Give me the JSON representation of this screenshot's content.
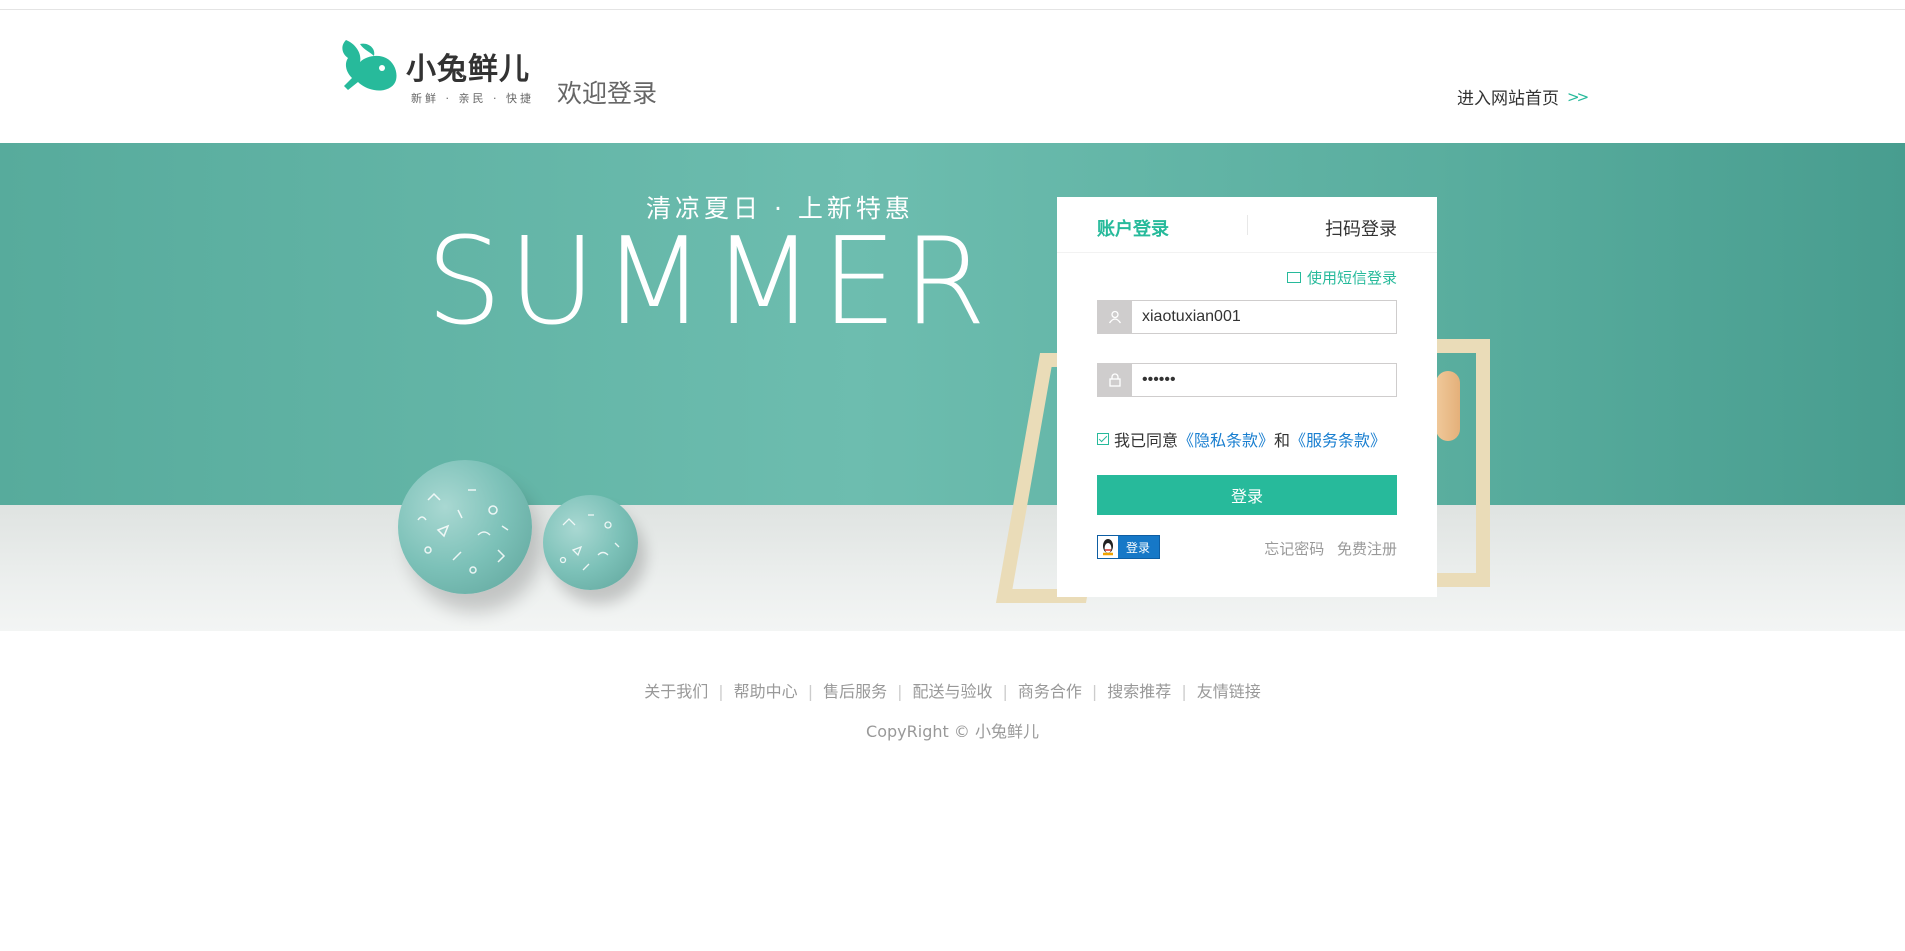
{
  "header": {
    "logo_name": "小兔鲜儿",
    "logo_tagline": "新鲜 · 亲民 · 快捷",
    "welcome": "欢迎登录",
    "home_link": "进入网站首页",
    "home_link_icon": "double-chevron-right-icon"
  },
  "banner": {
    "slogan": "清凉夏日 · 上新特惠",
    "headline": "SUMMER"
  },
  "login": {
    "tabs": [
      "账户登录",
      "扫码登录"
    ],
    "active_tab": "账户登录",
    "sms_link": "使用短信登录",
    "username_value": "xiaotuxian001",
    "password_value": "••••••",
    "agree_prefix": "我已同意",
    "privacy_link": "《隐私条款》",
    "agree_and": "和",
    "service_link": "《服务条款》",
    "agree_checked": true,
    "submit": "登录",
    "qq_login": "登录",
    "forgot": "忘记密码",
    "register": "免费注册"
  },
  "footer": {
    "links": [
      "关于我们",
      "帮助中心",
      "售后服务",
      "配送与验收",
      "商务合作",
      "搜索推荐",
      "友情链接"
    ],
    "copyright": "CopyRight © 小兔鲜儿"
  },
  "colors": {
    "brand": "#27BA9B",
    "link_blue": "#1a7fd0",
    "banner_bg": "#6dbdaf"
  }
}
